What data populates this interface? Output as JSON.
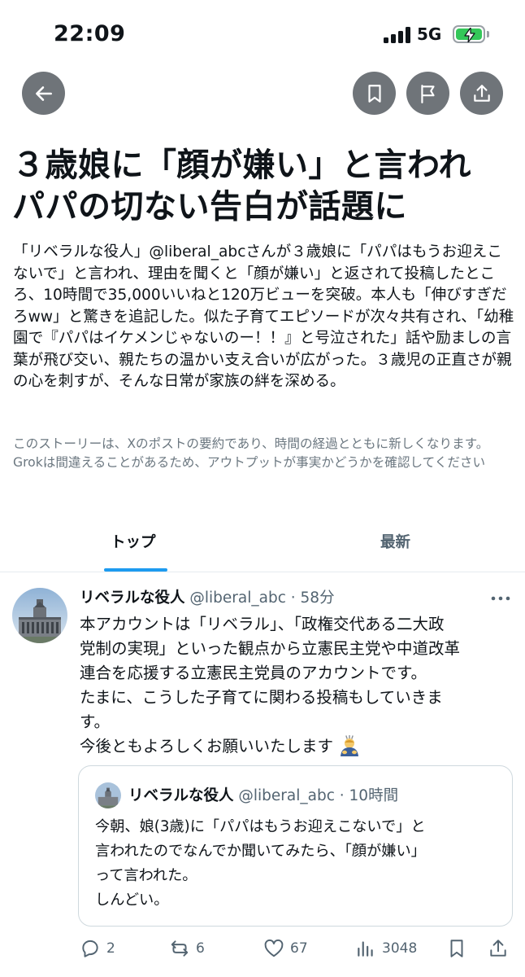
{
  "status_bar": {
    "time": "22:09",
    "network": "5G"
  },
  "toolbar": {
    "back_icon": "arrow-left-icon",
    "bookmark_icon": "bookmark-icon",
    "flag_icon": "flag-icon",
    "share_icon": "share-icon"
  },
  "article": {
    "headline_line1": "３歳娘に「顔が嫌い」と言われ",
    "headline_line2": "パパの切ない告白が話題に",
    "summary": "「リベラルな役人」@liberal_abcさんが３歳娘に「パパはもうお迎えこないで」と言われ、理由を聞くと「顔が嫌い」と返されて投稿したところ、10時間で35,000いいねと120万ビューを突破。本人も「伸びすぎだろww」と驚きを追記した。似た子育てエピソードが次々共有され、「幼稚園で『パパはイケメンじゃないのー！！』と号泣された」話や励ましの言葉が飛び交い、親たちの温かい支え合いが広がった。３歳児の正直さが親の心を刺すが、そんな日常が家族の絆を深める。",
    "disclaimer": "このストーリーは、Xのポストの要約であり、時間の経過とともに新しくなります。Grokは間違えることがあるため、アウトプットが事実かどうかを確認してください"
  },
  "tabs": [
    {
      "label": "トップ",
      "active": true
    },
    {
      "label": "最新",
      "active": false
    }
  ],
  "post": {
    "author": "リベラルな役人",
    "meta": "@liberal_abc · 58分",
    "body_line1": "本アカウントは「リベラル」、「政権交代ある二大政",
    "body_line2": "党制の実現」といった観点から立憲民主党や中道改革",
    "body_line3": "連合を応援する立憲民主党員のアカウントです。",
    "body_line4": "たまに、こうした子育てに関わる投稿もしていきま",
    "body_line5": "す。",
    "body_line6": "今後ともよろしくお願いいたします",
    "emoji": "bowing-person-emoji"
  },
  "quote": {
    "author": "リベラルな役人",
    "meta": "@liberal_abc · 10時間",
    "body_line1": "今朝、娘(3歳)に「パパはもうお迎えこないで」と",
    "body_line2": "言われたのでなんでか聞いてみたら、「顔が嫌い」",
    "body_line3": "って言われた。",
    "body_line4": "しんどい。"
  },
  "actions": {
    "replies": "2",
    "reposts": "6",
    "likes": "67",
    "views": "3048"
  },
  "colors": {
    "accent": "#1d9bf0",
    "text": "#0f1419",
    "muted": "#536471",
    "button_bg": "#6f7479"
  }
}
